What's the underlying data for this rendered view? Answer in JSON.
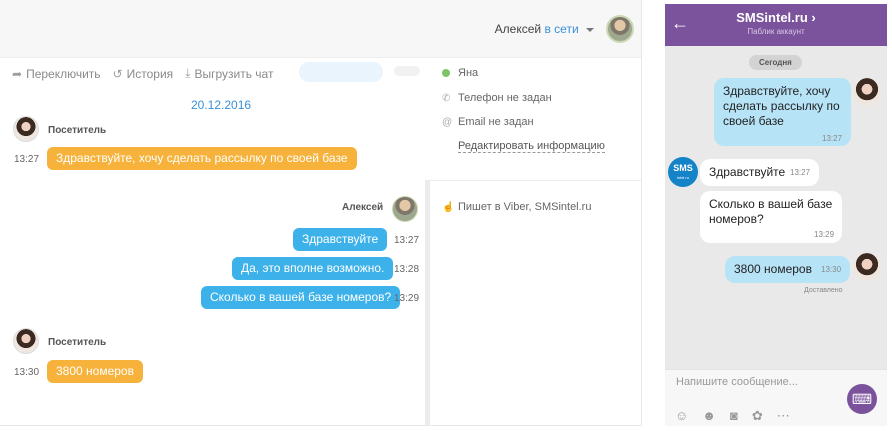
{
  "operator_panel": {
    "user_name": "Алексей",
    "user_status": "в сети",
    "toolbar": {
      "switch": "Переключить",
      "history": "История",
      "export": "Выгрузить чат"
    },
    "date": "20.12.2016",
    "messages": [
      {
        "sender": "Посетитель",
        "time": "13:27",
        "text": "Здравствуйте, хочу сделать рассылку по своей базе",
        "side": "left"
      },
      {
        "sender": "Алексей",
        "time": "13:27",
        "text": "Здравствуйте",
        "side": "right"
      },
      {
        "time": "13:28",
        "text": "Да, это вполне возможно.",
        "side": "right"
      },
      {
        "time": "13:29",
        "text": "Сколько в вашей базе номеров?",
        "side": "right"
      },
      {
        "sender": "Посетитель",
        "time": "13:30",
        "text": "3800 номеров",
        "side": "left"
      }
    ],
    "visitor_info": {
      "name": "Яна",
      "phone": "Телефон не задан",
      "email": "Email не задан",
      "edit_link": "Редактировать информацию",
      "source": "Пишет в Viber, SMSintel.ru"
    }
  },
  "viber_panel": {
    "title": "SMSintel.ru",
    "subtitle": "Паблик аккаунт",
    "day_label": "Сегодня",
    "messages": [
      {
        "side": "right",
        "text": "Здравствуйте, хочу сделать рассылку по своей базе",
        "time": "13:27"
      },
      {
        "side": "left",
        "text": "Здравствуйте",
        "time": "13:27"
      },
      {
        "side": "left",
        "text": "Сколько в вашей базе номеров?",
        "time": "13:29"
      },
      {
        "side": "right",
        "text": "3800 номеров",
        "time": "13:30"
      }
    ],
    "delivered_label": "Доставлено",
    "input_placeholder": "Напишите сообщение...",
    "avatar_text": "SMS",
    "avatar_subtext": "intel.ru"
  },
  "colors": {
    "visitor_bubble": "#f6b23b",
    "operator_bubble": "#3db2ea",
    "viber_purple": "#7b539c",
    "viber_outgoing": "#b7e3f7",
    "link_blue": "#3a8fd9"
  }
}
